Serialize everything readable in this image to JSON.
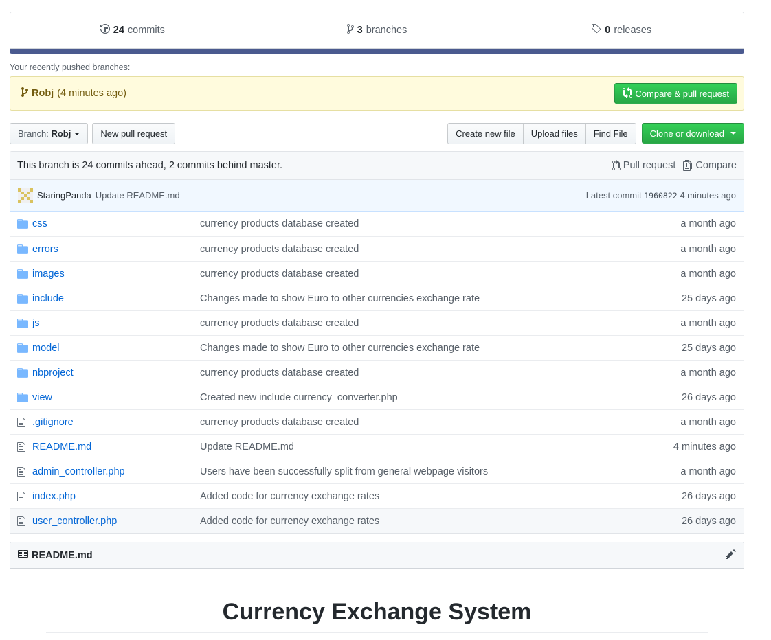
{
  "summary": {
    "commits": {
      "count": "24",
      "label": "commits",
      "icon": "history-icon"
    },
    "branches": {
      "count": "3",
      "label": "branches",
      "icon": "branch-icon"
    },
    "releases": {
      "count": "0",
      "label": "releases",
      "icon": "tag-icon"
    }
  },
  "recent": {
    "label": "Your recently pushed branches:",
    "branch": "Robj",
    "time": "(4 minutes ago)",
    "compare_button": "Compare & pull request"
  },
  "nav": {
    "branch_prefix": "Branch:",
    "branch_name": "Robj",
    "new_pr": "New pull request",
    "create_file": "Create new file",
    "upload_files": "Upload files",
    "find_file": "Find File",
    "clone": "Clone or download"
  },
  "branch_info": {
    "text": "This branch is 24 commits ahead, 2 commits behind master.",
    "pull_request": "Pull request",
    "compare": "Compare"
  },
  "latest_commit": {
    "author": "StaringPanda",
    "message": "Update README.md",
    "prefix": "Latest commit",
    "sha": "1960822",
    "time": "4 minutes ago"
  },
  "files": [
    {
      "type": "dir",
      "name": "css",
      "message": "currency products database created",
      "age": "a month ago"
    },
    {
      "type": "dir",
      "name": "errors",
      "message": "currency products database created",
      "age": "a month ago"
    },
    {
      "type": "dir",
      "name": "images",
      "message": "currency products database created",
      "age": "a month ago"
    },
    {
      "type": "dir",
      "name": "include",
      "message": "Changes made to show Euro to other currencies exchange rate",
      "age": "25 days ago"
    },
    {
      "type": "dir",
      "name": "js",
      "message": "currency products database created",
      "age": "a month ago"
    },
    {
      "type": "dir",
      "name": "model",
      "message": "Changes made to show Euro to other currencies exchange rate",
      "age": "25 days ago"
    },
    {
      "type": "dir",
      "name": "nbproject",
      "message": "currency products database created",
      "age": "a month ago"
    },
    {
      "type": "dir",
      "name": "view",
      "message": "Created new include currency_converter.php",
      "age": "26 days ago"
    },
    {
      "type": "file",
      "name": ".gitignore",
      "message": "currency products database created",
      "age": "a month ago"
    },
    {
      "type": "file",
      "name": "README.md",
      "message": "Update README.md",
      "age": "4 minutes ago"
    },
    {
      "type": "file",
      "name": "admin_controller.php",
      "message": "Users have been successfully split from general webpage visitors",
      "age": "a month ago"
    },
    {
      "type": "file",
      "name": "index.php",
      "message": "Added code for currency exchange rates",
      "age": "26 days ago"
    },
    {
      "type": "file",
      "name": "user_controller.php",
      "message": "Added code for currency exchange rates",
      "age": "26 days ago"
    }
  ],
  "readme": {
    "filename": "README.md",
    "heading": "Currency Exchange System"
  },
  "colors": {
    "link": "#0366d6",
    "green": "#28a745",
    "summary_bar": "#4a5a8f",
    "folder": "#79b8ff"
  }
}
